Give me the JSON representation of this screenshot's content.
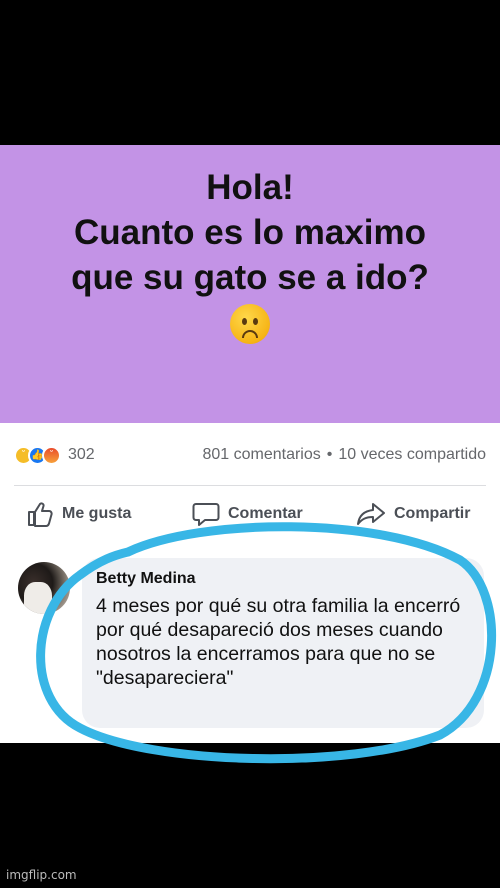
{
  "post": {
    "line1": "Hola!",
    "line2": "Cuanto es lo maximo",
    "line3": "que su gato se a ido?",
    "emoji": "sad-face-emoji",
    "background": "#c393e6"
  },
  "stats": {
    "reactions": [
      "sad-reaction-icon",
      "like-reaction-icon",
      "angry-reaction-icon"
    ],
    "reaction_count": "302",
    "comments": "801 comentarios",
    "separator": "•",
    "shares": "10 veces compartido"
  },
  "actions": {
    "like": "Me gusta",
    "comment": "Comentar",
    "share": "Compartir"
  },
  "comment": {
    "author": "Betty Medina",
    "text": "4 meses por qué su otra familia la encerró por qué desapareció dos meses cuando nosotros la encerramos para que no se \"desapareciera\""
  },
  "highlight_color": "#38b6e6",
  "watermark": "imgflip.com"
}
